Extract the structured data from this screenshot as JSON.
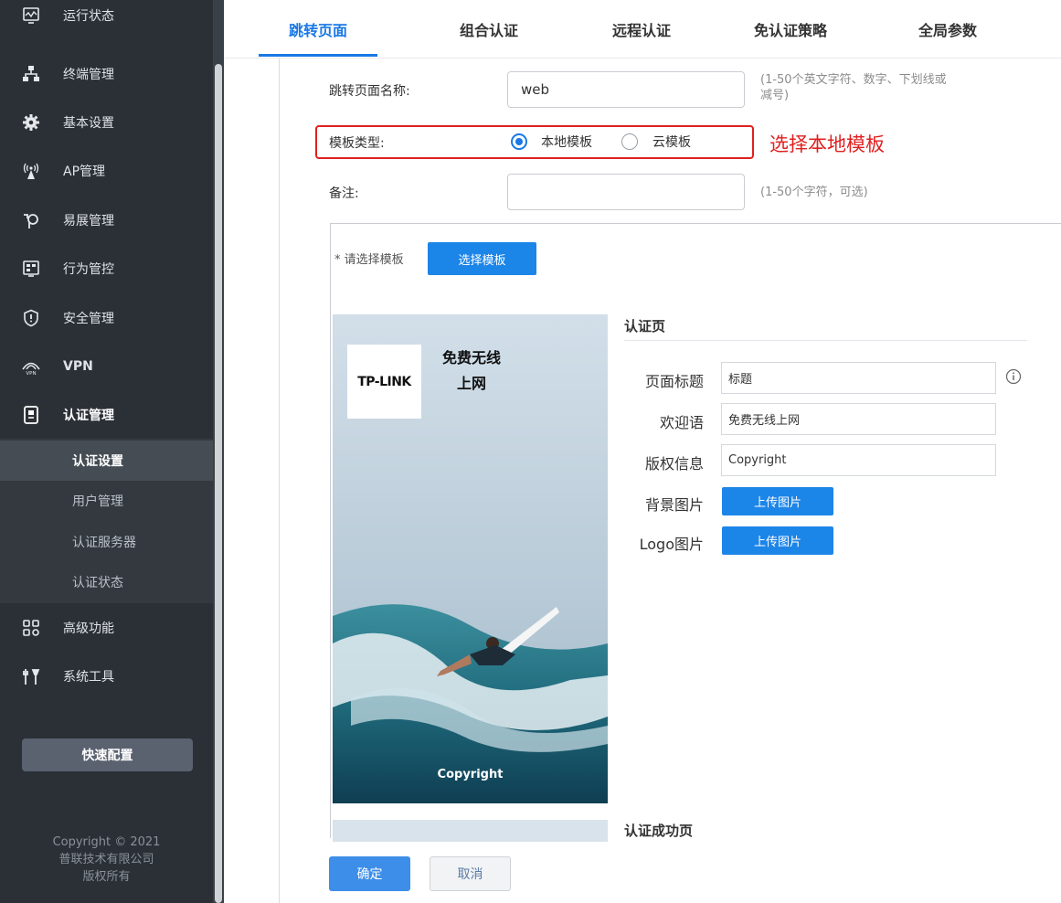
{
  "sidebar": {
    "items": [
      {
        "label": "运行状态",
        "icon": "monitor-icon"
      },
      {
        "label": "终端管理",
        "icon": "network-icon"
      },
      {
        "label": "基本设置",
        "icon": "gear-icon"
      },
      {
        "label": "AP管理",
        "icon": "wireless-ap-icon"
      },
      {
        "label": "易展管理",
        "icon": "mesh-icon"
      },
      {
        "label": "行为管控",
        "icon": "behavior-control-icon"
      },
      {
        "label": "安全管理",
        "icon": "shield-icon"
      },
      {
        "label": "VPN",
        "icon": "vpn-icon"
      },
      {
        "label": "认证管理",
        "icon": "auth-device-icon"
      },
      {
        "label": "高级功能",
        "icon": "grid-gear-icon"
      },
      {
        "label": "系统工具",
        "icon": "tools-icon"
      }
    ],
    "submenu": [
      "认证设置",
      "用户管理",
      "认证服务器",
      "认证状态"
    ],
    "quick_config": "快速配置",
    "copyright": [
      "Copyright © 2021",
      "普联技术有限公司",
      "版权所有"
    ]
  },
  "tabs": [
    "跳转页面",
    "组合认证",
    "远程认证",
    "免认证策略",
    "全局参数"
  ],
  "form": {
    "name_label": "跳转页面名称:",
    "name_value": "web",
    "name_hint_line1": "(1-50个英文字符、数字、下划线或",
    "name_hint_line2": "减号)",
    "template_label": "模板类型:",
    "template_local": "本地模板",
    "template_cloud": "云模板",
    "template_selected": "本地模板",
    "annotation": "选择本地模板",
    "remark_label": "备注:",
    "remark_value": "",
    "remark_hint": "(1-50个字符，可选)"
  },
  "template_panel": {
    "required_label": "* 请选择模板",
    "select_button": "选择模板",
    "preview": {
      "logo": "TP-LINK",
      "title_line1": "免费无线",
      "title_line2": "上网",
      "copyright": "Copyright"
    },
    "auth_page": {
      "section_title": "认证页",
      "fields": [
        {
          "label": "页面标题",
          "value": "标题"
        },
        {
          "label": "欢迎语",
          "value": "免费无线上网"
        },
        {
          "label": "版权信息",
          "value": "Copyright"
        }
      ],
      "bg_label": "背景图片",
      "logo_label": "Logo图片",
      "upload_button": "上传图片"
    },
    "success_section_title": "认证成功页"
  },
  "buttons": {
    "ok": "确定",
    "cancel": "取消"
  },
  "colors": {
    "accent": "#1978e5",
    "sidebar_bg": "#2b3036",
    "annotation": "#e02020"
  }
}
